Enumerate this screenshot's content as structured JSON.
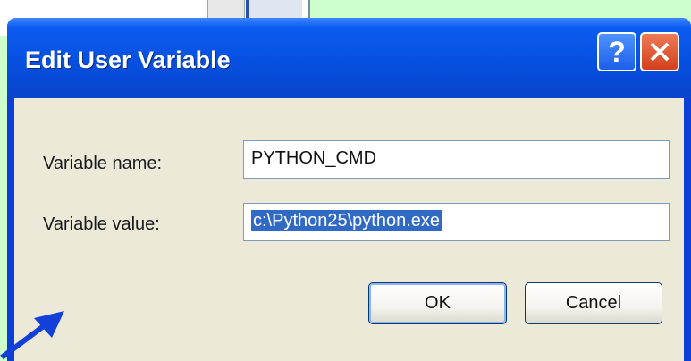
{
  "dialog": {
    "title": "Edit User Variable",
    "help_glyph": "?",
    "variable_name_label": "Variable name:",
    "variable_name_value": "PYTHON_CMD",
    "variable_value_label": "Variable value:",
    "variable_value_value": "c:\\Python25\\python.exe",
    "ok_label": "OK",
    "cancel_label": "Cancel"
  },
  "colors": {
    "background": "#ccffcc",
    "titlebar": "#0650e0",
    "close": "#d2401c",
    "selection": "#316ac5",
    "client": "#ece9d8",
    "arrow": "#1240d8"
  },
  "icons": {
    "help": "help-icon",
    "close": "close-icon",
    "pointer": "arrow-pointer-icon"
  }
}
